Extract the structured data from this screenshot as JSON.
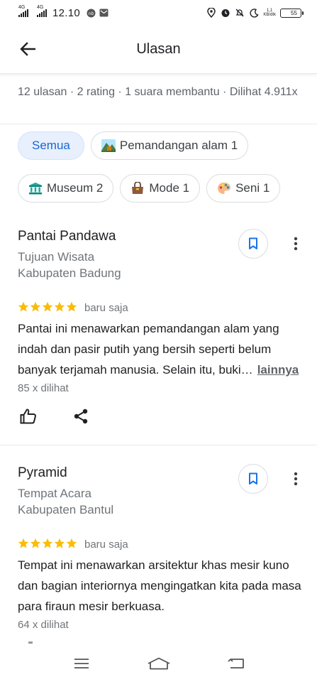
{
  "status_bar": {
    "network1": "4G",
    "network2": "4G",
    "time": "12.10",
    "speed_value": "1,1",
    "speed_unit": "KB/dtk",
    "battery": "55"
  },
  "header": {
    "title": "Ulasan"
  },
  "summary": {
    "text": "12 ulasan · 2 rating · 1 suara membantu · Dilihat 4.911x"
  },
  "filters": [
    {
      "label": "Semua",
      "emoji": "",
      "active": true
    },
    {
      "label": "Pemandangan alam 1",
      "emoji": "mountain-emoji"
    },
    {
      "label": "Museum 2",
      "emoji": "museum-emoji"
    },
    {
      "label": "Mode 1",
      "emoji": "handbag-emoji"
    },
    {
      "label": "Seni 1",
      "emoji": "palette-emoji"
    }
  ],
  "reviews": [
    {
      "place": "Pantai Pandawa",
      "category": "Tujuan Wisata",
      "region": "Kabupaten Badung",
      "rating": 5,
      "when": "baru saja",
      "text": "Pantai ini menawarkan pemandangan alam yang indah dan pasir putih yang bersih seperti belum banyak terjamah manusia. Selain itu, buki…",
      "more": "lainnya",
      "views": "85 x dilihat"
    },
    {
      "place": "Pyramid",
      "category": "Tempat Acara",
      "region": "Kabupaten Bantul",
      "rating": 5,
      "when": "baru saja",
      "text": "Tempat ini menawarkan arsitektur khas mesir kuno dan bagian interiornya mengingatkan kita pada masa para firaun mesir berkuasa.",
      "views": "64 x dilihat"
    }
  ],
  "colors": {
    "accent": "#1a73e8",
    "chip_active_bg": "#e8f0fe",
    "star": "#fbbc04",
    "text_primary": "#202124",
    "text_secondary": "#70757a"
  },
  "icons": {
    "back": "arrow-left-icon",
    "bookmark": "bookmark-icon",
    "more": "more-vert-icon",
    "like": "thumb-up-icon",
    "share": "share-icon"
  }
}
